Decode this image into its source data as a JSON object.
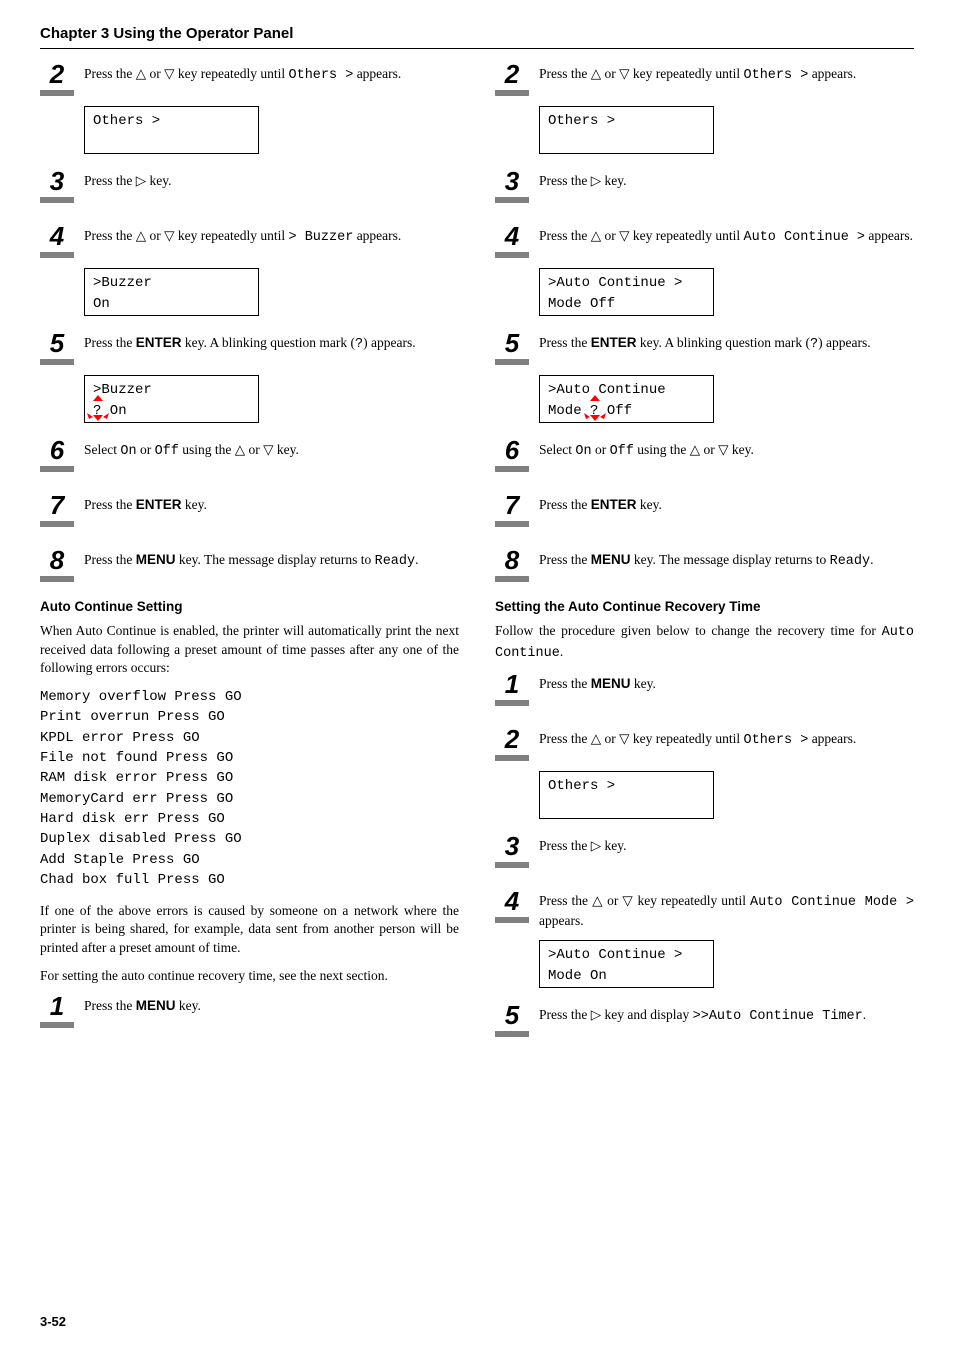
{
  "chapter_title": "Chapter 3  Using the Operator Panel",
  "left": {
    "s2": {
      "num": "2",
      "text_a": "Press the ",
      "text_b": " or ",
      "text_c": " key repeatedly until ",
      "code": "Others  >",
      "text_d": " appears."
    },
    "d2": {
      "l1": "Others        >"
    },
    "s3": {
      "num": "3",
      "text_a": "Press the ",
      "text_b": " key."
    },
    "s4": {
      "num": "4",
      "text_a": "Press the ",
      "text_b": " or ",
      "text_c": " key repeatedly until ",
      "code": "> Buzzer",
      "text_d": " appears."
    },
    "d4": {
      "l1": ">Buzzer",
      "l2": " On"
    },
    "s5": {
      "num": "5",
      "text_a": "Press the ",
      "key": "ENTER",
      "text_b": " key. A blinking question mark (",
      "q": "?",
      "text_c": ") appears."
    },
    "d5": {
      "l1": ">Buzzer",
      "l2_a": "?",
      "l2_b": " On"
    },
    "s6": {
      "num": "6",
      "text_a": "Select ",
      "c1": "On",
      "text_b": " or ",
      "c2": "Off",
      "text_c": " using the ",
      "text_d": " or ",
      "text_e": " key."
    },
    "s7": {
      "num": "7",
      "text_a": "Press the ",
      "key": "ENTER",
      "text_b": " key."
    },
    "s8": {
      "num": "8",
      "text_a": "Press the ",
      "key": "MENU",
      "text_b": " key. The message display returns to ",
      "code": "Ready",
      "text_c": "."
    },
    "sub1": "Auto Continue Setting",
    "para1": "When Auto Continue is enabled, the printer will automatically print the next received data following a preset amount of time passes after any one of the following errors occurs:",
    "errors": [
      "Memory overflow Press GO",
      "Print overrun Press GO",
      "KPDL error Press GO",
      "File not found Press GO",
      "RAM disk error Press GO",
      "MemoryCard err Press GO",
      "Hard disk err Press GO",
      "Duplex disabled Press GO",
      "Add Staple Press GO",
      "Chad box full Press GO"
    ],
    "para2": "If one of the above errors is caused by someone on a network where the printer is being shared, for example, data sent from another person will be printed after a preset amount of time.",
    "para3": "For setting the auto continue recovery time, see the next section.",
    "s1b": {
      "num": "1",
      "text_a": "Press the ",
      "key": "MENU",
      "text_b": " key."
    }
  },
  "right": {
    "s2": {
      "num": "2",
      "text_a": "Press the ",
      "text_b": " or ",
      "text_c": " key repeatedly until ",
      "code": "Others  >",
      "text_d": " appears."
    },
    "d2": {
      "l1": "Others        >"
    },
    "s3": {
      "num": "3",
      "text_a": "Press the ",
      "text_b": " key."
    },
    "s4": {
      "num": "4",
      "text_a": "Press the ",
      "text_b": " or ",
      "text_c": " key repeatedly until ",
      "code": "Auto Continue >",
      "text_d": " appears."
    },
    "d4": {
      "l1": ">Auto Continue >",
      "l2": " Mode   Off"
    },
    "s5": {
      "num": "5",
      "text_a": "Press the ",
      "key": "ENTER",
      "text_b": " key. A blinking question mark (",
      "q": "?",
      "text_c": ") appears."
    },
    "d5": {
      "l1": ">Auto Continue",
      "l2_a": " Mode ",
      "l2_b": "?",
      "l2_c": " Off"
    },
    "s6": {
      "num": "6",
      "text_a": "Select ",
      "c1": "On",
      "text_b": " or ",
      "c2": "Off",
      "text_c": " using the ",
      "text_d": " or ",
      "text_e": " key."
    },
    "s7": {
      "num": "7",
      "text_a": "Press the ",
      "key": "ENTER",
      "text_b": " key."
    },
    "s8": {
      "num": "8",
      "text_a": "Press the ",
      "key": "MENU",
      "text_b": " key. The message display returns to ",
      "code": "Ready",
      "text_c": "."
    },
    "sub2": "Setting the Auto Continue Recovery Time",
    "para4": "Follow the procedure given below to change the recovery time for ",
    "para4_code": "Auto Continue",
    "para4_end": ".",
    "s1c": {
      "num": "1",
      "text_a": "Press the ",
      "key": "MENU",
      "text_b": " key."
    },
    "s2c": {
      "num": "2",
      "text_a": "Press the ",
      "text_b": " or ",
      "text_c": " key repeatedly until ",
      "code": "Others  >",
      "text_d": " appears."
    },
    "d2c": {
      "l1": "Others        >"
    },
    "s3c": {
      "num": "3",
      "text_a": "Press the ",
      "text_b": " key."
    },
    "s4c": {
      "num": "4",
      "text_a": "Press the ",
      "text_b": " or ",
      "text_c": " key repeatedly until ",
      "code": "Auto Continue Mode >",
      "text_d": " appears."
    },
    "d4c": {
      "l1": ">Auto Continue >",
      "l2": "Mode   On"
    },
    "s5c": {
      "num": "5",
      "text_a": "Press the ",
      "text_b": " key and display ",
      "code": ">>Auto  Continue Timer",
      "text_c": "."
    }
  },
  "footer": "3-52"
}
